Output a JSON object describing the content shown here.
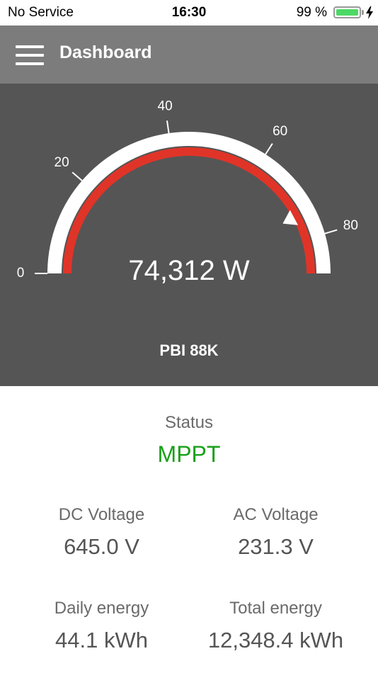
{
  "status_bar": {
    "carrier": "No Service",
    "time": "16:30",
    "battery_percent": "99 %",
    "battery_level": 0.99,
    "icons": [
      "battery-icon",
      "charging-bolt-icon"
    ]
  },
  "header": {
    "menu_icon": "hamburger-menu-icon",
    "title": "Dashboard"
  },
  "gauge": {
    "min": 0,
    "max": 88,
    "ticks": [
      {
        "value": 0,
        "label": "0"
      },
      {
        "value": 20,
        "label": "20"
      },
      {
        "value": 40,
        "label": "40"
      },
      {
        "value": 60,
        "label": "60"
      },
      {
        "value": 80,
        "label": "80"
      }
    ],
    "current_value": 74.312,
    "marker_value": 74.312,
    "power_readout": "74,312 W",
    "device_name": "PBI 88K",
    "colors": {
      "panel": "#555555",
      "track": "#ffffff",
      "value_arc": "#e03428",
      "marker": "#ffffff"
    }
  },
  "info": {
    "status_label": "Status",
    "status_value": "MPPT",
    "status_color": "#1aa01a",
    "metrics": [
      {
        "label": "DC Voltage",
        "value": "645.0 V"
      },
      {
        "label": "AC Voltage",
        "value": "231.3 V"
      },
      {
        "label": "Daily energy",
        "value": "44.1 kWh"
      },
      {
        "label": "Total energy",
        "value": "12,348.4 kWh"
      }
    ]
  }
}
